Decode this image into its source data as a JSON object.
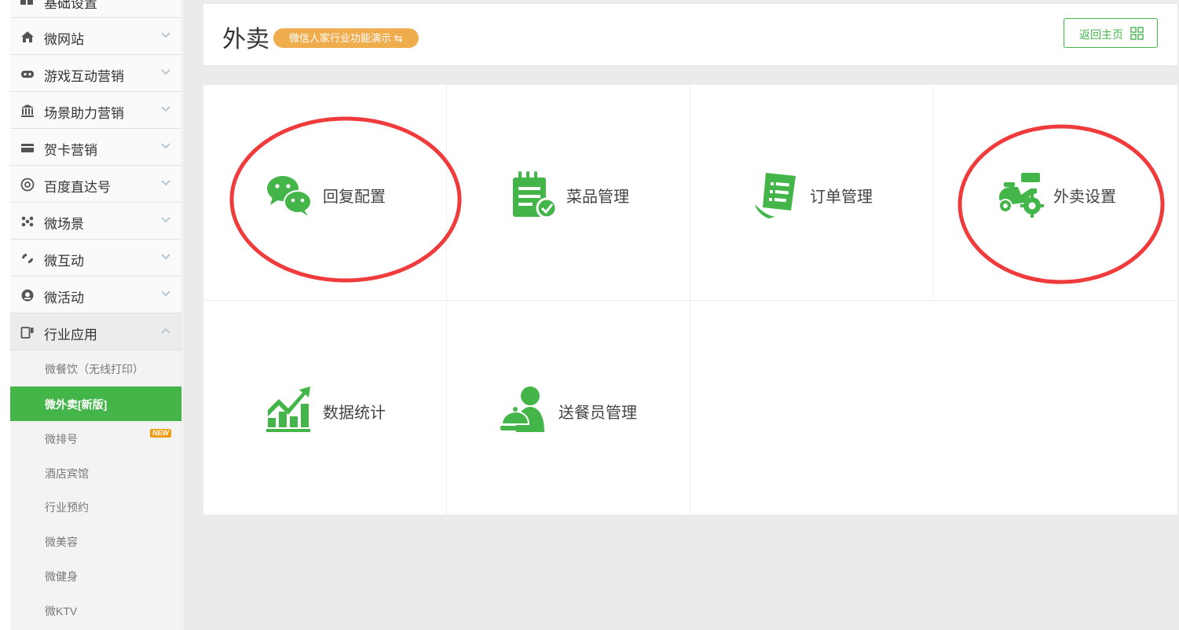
{
  "theme": {
    "accent": "#44b549",
    "badge": "#f0ad4e",
    "annotation": "#ef3b3b"
  },
  "sidebar": {
    "partial_item": {
      "label": "基础设置",
      "icon": "grid-icon"
    },
    "items": [
      {
        "label": "微网站",
        "icon": "home-icon"
      },
      {
        "label": "游戏互动营销",
        "icon": "gamepad-icon"
      },
      {
        "label": "场景助力营销",
        "icon": "bank-icon"
      },
      {
        "label": "贺卡营销",
        "icon": "card-icon"
      },
      {
        "label": "百度直达号",
        "icon": "at-icon"
      },
      {
        "label": "微场景",
        "icon": "scene-icon"
      },
      {
        "label": "微互动",
        "icon": "interact-icon"
      },
      {
        "label": "微活动",
        "icon": "activity-icon"
      },
      {
        "label": "行业应用",
        "icon": "industry-icon"
      }
    ],
    "sub_items": [
      {
        "label": "微餐饮（无线打印）"
      },
      {
        "label": "微外卖[新版]"
      },
      {
        "label": "微排号",
        "badge": "NEW"
      },
      {
        "label": "酒店宾馆"
      },
      {
        "label": "行业预约"
      },
      {
        "label": "微美容"
      },
      {
        "label": "微健身"
      },
      {
        "label": "微KTV"
      }
    ]
  },
  "header": {
    "title": "外卖",
    "demo_badge": "微信人家行业功能演示 ⇆",
    "home_button": "返回主页"
  },
  "tiles": [
    {
      "label": "回复配置",
      "icon": "wechat-icon"
    },
    {
      "label": "菜品管理",
      "icon": "menu-list-icon"
    },
    {
      "label": "订单管理",
      "icon": "order-receipt-icon"
    },
    {
      "label": "外卖设置",
      "icon": "scooter-settings-icon"
    },
    {
      "label": "数据统计",
      "icon": "chart-growth-icon"
    },
    {
      "label": "送餐员管理",
      "icon": "delivery-person-icon"
    }
  ]
}
